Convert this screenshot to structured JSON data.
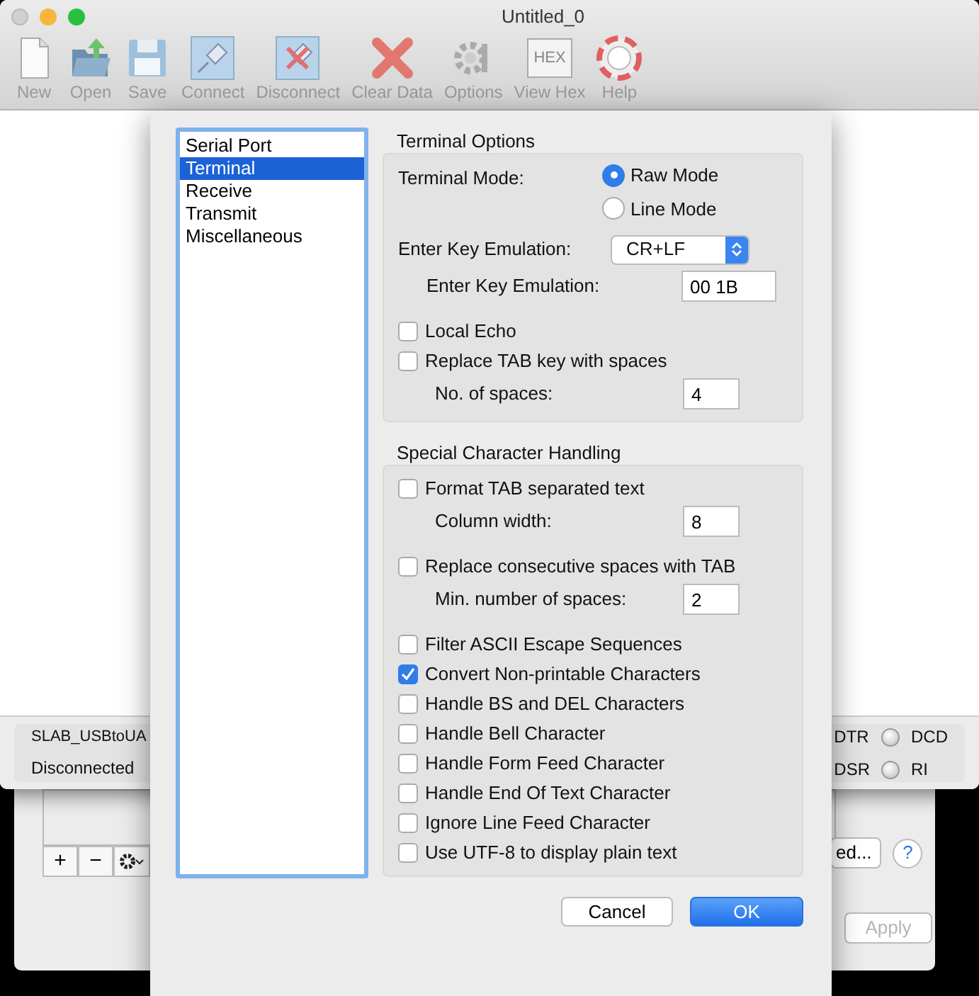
{
  "window": {
    "title": "Untitled_0"
  },
  "toolbar": [
    {
      "label": "New",
      "kind": "new"
    },
    {
      "label": "Open",
      "kind": "open"
    },
    {
      "label": "Save",
      "kind": "save"
    },
    {
      "label": "Connect",
      "kind": "connect"
    },
    {
      "label": "Disconnect",
      "kind": "disconnect"
    },
    {
      "label": "Clear Data",
      "kind": "clear"
    },
    {
      "label": "Options",
      "kind": "options"
    },
    {
      "label": "View Hex",
      "kind": "hex",
      "icon_text": "HEX"
    },
    {
      "label": "Help",
      "kind": "help"
    }
  ],
  "status_bar": {
    "port": "SLAB_USBtoUA",
    "state": "Disconnected",
    "indicators": [
      {
        "label": "DTR"
      },
      {
        "label": "DCD"
      },
      {
        "label": "DSR"
      },
      {
        "label": "RI"
      }
    ]
  },
  "back_window": {
    "list_buttons": [
      "+",
      "−"
    ],
    "button": "ed...",
    "help": "?",
    "apply": {
      "label": "Apply",
      "disabled": true
    }
  },
  "dialog": {
    "categories": [
      {
        "label": "Serial Port",
        "selected": false
      },
      {
        "label": "Terminal",
        "selected": true
      },
      {
        "label": "Receive",
        "selected": false
      },
      {
        "label": "Transmit",
        "selected": false
      },
      {
        "label": "Miscellaneous",
        "selected": false
      }
    ],
    "sections": [
      {
        "title": "Terminal Options",
        "rows": [
          {
            "kind": "radio_group",
            "label": "Terminal Mode:",
            "options": [
              {
                "label": "Raw Mode",
                "selected": true
              },
              {
                "label": "Line Mode",
                "selected": false
              }
            ]
          },
          {
            "kind": "select",
            "label": "Enter Key Emulation:",
            "value": "CR+LF"
          },
          {
            "kind": "field",
            "label": "Enter Key Emulation:",
            "value": "00 1B",
            "wide": true
          },
          {
            "kind": "checkbox",
            "label": "Local Echo",
            "checked": false
          },
          {
            "kind": "checkbox",
            "label": "Replace TAB key with spaces",
            "checked": false
          },
          {
            "kind": "field",
            "label": "No. of spaces:",
            "value": "4"
          }
        ]
      },
      {
        "title": "Special Character Handling",
        "rows": [
          {
            "kind": "checkbox",
            "label": "Format TAB separated text",
            "checked": false
          },
          {
            "kind": "field",
            "label": "Column width:",
            "value": "8"
          },
          {
            "kind": "checkbox",
            "label": "Replace consecutive spaces with TAB",
            "checked": false
          },
          {
            "kind": "field",
            "label": "Min. number of spaces:",
            "value": "2"
          },
          {
            "kind": "checkbox",
            "label": "Filter ASCII Escape Sequences",
            "checked": false
          },
          {
            "kind": "checkbox",
            "label": "Convert Non-printable Characters",
            "checked": true
          },
          {
            "kind": "checkbox",
            "label": "Handle BS and DEL Characters",
            "checked": false
          },
          {
            "kind": "checkbox",
            "label": "Handle Bell Character",
            "checked": false
          },
          {
            "kind": "checkbox",
            "label": "Handle Form Feed Character",
            "checked": false
          },
          {
            "kind": "checkbox",
            "label": "Handle End Of Text Character",
            "checked": false
          },
          {
            "kind": "checkbox",
            "label": "Ignore Line Feed Character",
            "checked": false
          },
          {
            "kind": "checkbox",
            "label": "Use UTF-8 to display plain text",
            "checked": false
          }
        ]
      }
    ],
    "buttons": [
      {
        "label": "Cancel",
        "kind": "cancel"
      },
      {
        "label": "OK",
        "kind": "default"
      }
    ]
  }
}
